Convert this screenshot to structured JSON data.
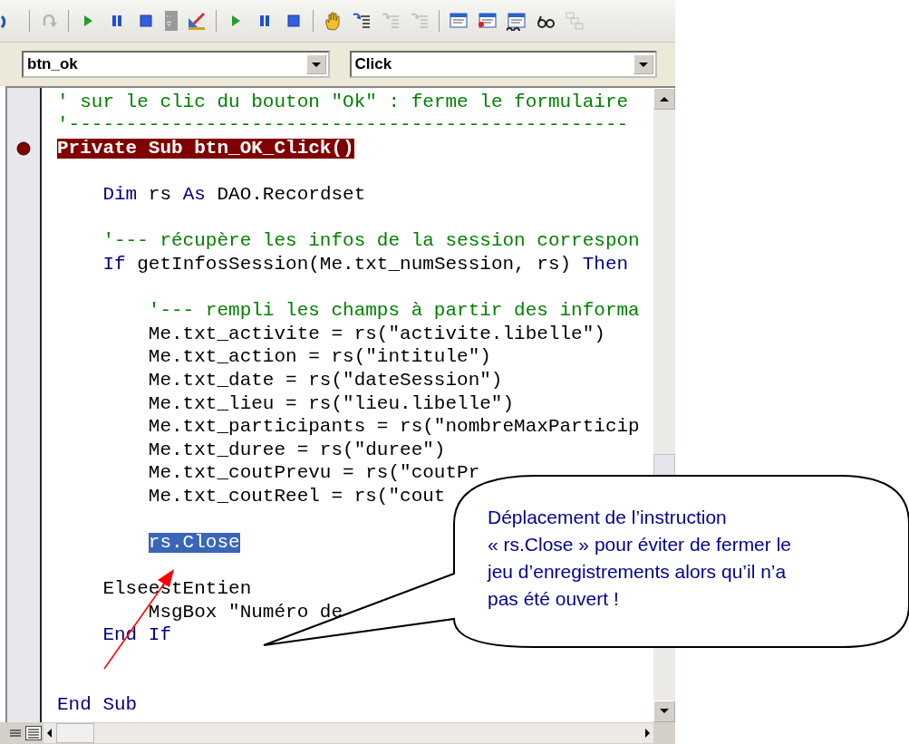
{
  "toolbar": {
    "buttons": [
      {
        "kind": "undo",
        "disabled": false
      },
      {
        "kind": "redo",
        "disabled": true
      },
      {
        "kind": "run",
        "disabled": false
      },
      {
        "kind": "pause",
        "disabled": false
      },
      {
        "kind": "stop",
        "disabled": false
      },
      {
        "kind": "grip",
        "disabled": false
      },
      {
        "kind": "design",
        "disabled": false
      },
      {
        "kind": "run",
        "disabled": false
      },
      {
        "kind": "pause",
        "disabled": false
      },
      {
        "kind": "stop",
        "disabled": false
      },
      {
        "kind": "hand",
        "disabled": false
      },
      {
        "kind": "stepin",
        "disabled": false
      },
      {
        "kind": "stepover",
        "disabled": true
      },
      {
        "kind": "stepout",
        "disabled": true
      },
      {
        "kind": "window",
        "disabled": false
      },
      {
        "kind": "windowalert",
        "disabled": false
      },
      {
        "kind": "watch",
        "disabled": false
      },
      {
        "kind": "glasses",
        "disabled": false
      },
      {
        "kind": "stack",
        "disabled": true
      }
    ]
  },
  "object_combo": {
    "value": "btn_ok"
  },
  "procedure_combo": {
    "value": "Click"
  },
  "code_lines": [
    {
      "breakpoint": false,
      "selected": false,
      "tokens": [
        {
          "text": "' sur le clic du bouton \"Ok\" : ferme le formulaire",
          "kind": "comment"
        }
      ]
    },
    {
      "breakpoint": false,
      "selected": false,
      "tokens": [
        {
          "text": "'-------------------------------------------------",
          "kind": "comment"
        }
      ]
    },
    {
      "breakpoint": true,
      "selected": false,
      "tokens": [
        {
          "text": "Private Sub btn_OK_Click()",
          "kind": "plain"
        }
      ]
    },
    {
      "breakpoint": false
    },
    {
      "breakpoint": false,
      "selected": false,
      "tokens": [
        {
          "text": "    Dim",
          "kind": "keyword"
        },
        {
          "text": " rs ",
          "kind": "plain"
        },
        {
          "text": "As",
          "kind": "keyword"
        },
        {
          "text": " DAO.Recordset",
          "kind": "plain"
        }
      ]
    },
    {
      "breakpoint": false
    },
    {
      "breakpoint": false,
      "selected": false,
      "tokens": [
        {
          "text": "    '--- récupère les infos de la session correspon",
          "kind": "comment"
        }
      ]
    },
    {
      "breakpoint": false,
      "selected": false,
      "tokens": [
        {
          "text": "    If",
          "kind": "keyword"
        },
        {
          "text": " getInfosSession(Me.txt_numSession, rs) ",
          "kind": "plain"
        },
        {
          "text": "Then",
          "kind": "keyword"
        }
      ]
    },
    {
      "breakpoint": false
    },
    {
      "breakpoint": false,
      "selected": false,
      "tokens": [
        {
          "text": "        '--- rempli les champs à partir des informa",
          "kind": "comment"
        }
      ]
    },
    {
      "breakpoint": false,
      "selected": false,
      "tokens": [
        {
          "text": "        Me.txt_activite = rs(\"activite.libelle\")",
          "kind": "plain"
        }
      ]
    },
    {
      "breakpoint": false,
      "selected": false,
      "tokens": [
        {
          "text": "        Me.txt_action = rs(\"intitule\")",
          "kind": "plain"
        }
      ]
    },
    {
      "breakpoint": false,
      "selected": false,
      "tokens": [
        {
          "text": "        Me.txt_date = rs(\"dateSession\")",
          "kind": "plain"
        }
      ]
    },
    {
      "breakpoint": false,
      "selected": false,
      "tokens": [
        {
          "text": "        Me.txt_lieu = rs(\"lieu.libelle\")",
          "kind": "plain"
        }
      ]
    },
    {
      "breakpoint": false,
      "selected": false,
      "tokens": [
        {
          "text": "        Me.txt_participants = rs(\"nombreMaxParticip",
          "kind": "plain"
        }
      ]
    },
    {
      "breakpoint": false,
      "selected": false,
      "tokens": [
        {
          "text": "        Me.txt_duree = rs(\"duree\")",
          "kind": "plain"
        }
      ]
    },
    {
      "breakpoint": false,
      "selected": false,
      "tokens": [
        {
          "text": "        Me.txt_coutPrevu = rs(\"coutPr",
          "kind": "plain"
        }
      ]
    },
    {
      "breakpoint": false,
      "selected": false,
      "tokens": [
        {
          "text": "        Me.txt_coutReel = rs(\"cout",
          "kind": "plain"
        }
      ]
    },
    {
      "breakpoint": false
    },
    {
      "breakpoint": false,
      "selected": true,
      "tokens": [
        {
          "text": "        rs.Close",
          "kind": "plain"
        }
      ]
    },
    {
      "breakpoint": false
    },
    {
      "breakpoint": false,
      "selected": false,
      "tokens": [
        {
          "text": "    ElseestEntien",
          "kind": "plain"
        }
      ]
    },
    {
      "breakpoint": false,
      "selected": false,
      "tokens": [
        {
          "text": "        MsgBox \"Numéro de",
          "kind": "plain"
        }
      ]
    },
    {
      "breakpoint": false,
      "selected": false,
      "tokens": [
        {
          "text": "    End If",
          "kind": "keyword"
        }
      ]
    },
    {
      "breakpoint": false
    },
    {
      "breakpoint": false
    },
    {
      "breakpoint": false,
      "selected": false,
      "tokens": [
        {
          "text": "End Sub",
          "kind": "keyword"
        }
      ]
    }
  ],
  "callout": {
    "lines": [
      "Déplacement de l’instruction",
      "« rs.Close » pour éviter de fermer le",
      "jeu d’enregistrements alors qu’il n’a",
      "pas été ouvert !"
    ]
  }
}
